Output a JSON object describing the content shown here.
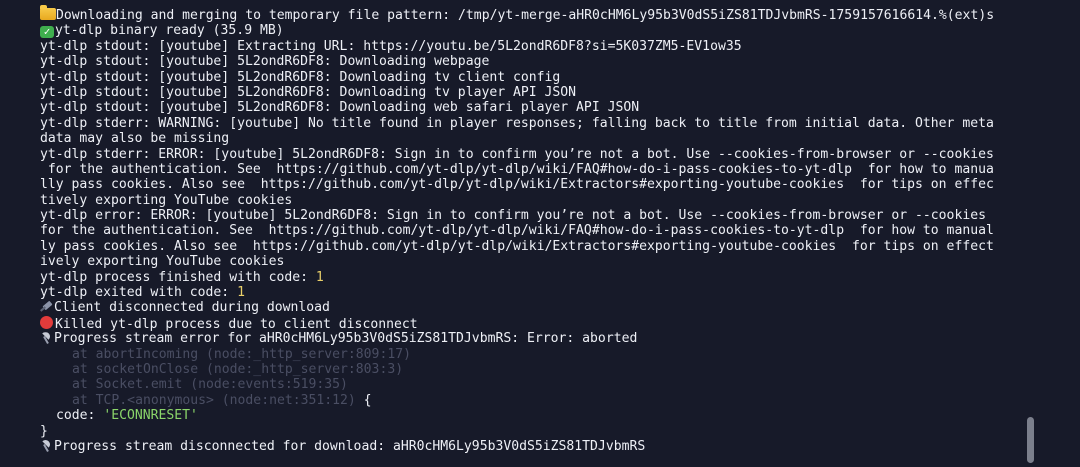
{
  "icons": {
    "folder": "folder-icon",
    "check": "check-mark-icon",
    "plug": "electric-plug-icon",
    "stop": "red-circle-icon",
    "antenna": "satellite-antenna-icon"
  },
  "log": {
    "l01": "Downloading and merging to temporary file pattern: /tmp/yt-merge-aHR0cHM6Ly95b3V0dS5iZS81TDJvbmRS-1759157616614.%(ext)s",
    "l02": "yt-dlp binary ready (35.9 MB)",
    "l03": "yt-dlp stdout: [youtube] Extracting URL: https://youtu.be/5L2ondR6DF8?si=5K037ZM5-EV1ow35",
    "l04": "yt-dlp stdout: [youtube] 5L2ondR6DF8: Downloading webpage",
    "l05": "yt-dlp stdout: [youtube] 5L2ondR6DF8: Downloading tv client config",
    "l06": "yt-dlp stdout: [youtube] 5L2ondR6DF8: Downloading tv player API JSON",
    "l07": "yt-dlp stdout: [youtube] 5L2ondR6DF8: Downloading web safari player API JSON",
    "l08": "yt-dlp stderr: WARNING: [youtube] No title found in player responses; falling back to title from initial data. Other meta",
    "l09": "data may also be missing",
    "l10": "yt-dlp stderr: ERROR: [youtube] 5L2ondR6DF8: Sign in to confirm you’re not a bot. Use --cookies-from-browser or --cookies",
    "l11": " for the authentication. See  https://github.com/yt-dlp/yt-dlp/wiki/FAQ#how-do-i-pass-cookies-to-yt-dlp  for how to manua",
    "l12": "lly pass cookies. Also see  https://github.com/yt-dlp/yt-dlp/wiki/Extractors#exporting-youtube-cookies  for tips on effec",
    "l13": "tively exporting YouTube cookies",
    "l14": "yt-dlp error: ERROR: [youtube] 5L2ondR6DF8: Sign in to confirm you’re not a bot. Use --cookies-from-browser or --cookies",
    "l15": "for the authentication. See  https://github.com/yt-dlp/yt-dlp/wiki/FAQ#how-do-i-pass-cookies-to-yt-dlp  for how to manual",
    "l16": "ly pass cookies. Also see  https://github.com/yt-dlp/yt-dlp/wiki/Extractors#exporting-youtube-cookies  for tips on effect",
    "l17": "ively exporting YouTube cookies",
    "l18_text": "yt-dlp process finished with code: ",
    "l18_code": "1",
    "l19_text": "yt-dlp exited with code: ",
    "l19_code": "1",
    "l20": "Client disconnected during download",
    "l21": "Killed yt-dlp process due to client disconnect",
    "l22": "Progress stream error for aHR0cHM6Ly95b3V0dS5iZS81TDJvbmRS: Error: aborted",
    "l23": "at abortIncoming (node:_http_server:809:17)",
    "l24": "at socketOnClose (node:_http_server:803:3)",
    "l25": "at Socket.emit (node:events:519:35)",
    "l26": "at TCP.<anonymous> (node:net:351:12)",
    "l26_brace": " {",
    "l27_key": "code: ",
    "l27_val": "'ECONNRESET'",
    "l28": "}",
    "l29": "Progress stream disconnected for download: aHR0cHM6Ly95b3V0dS5iZS81TDJvbmRS"
  }
}
